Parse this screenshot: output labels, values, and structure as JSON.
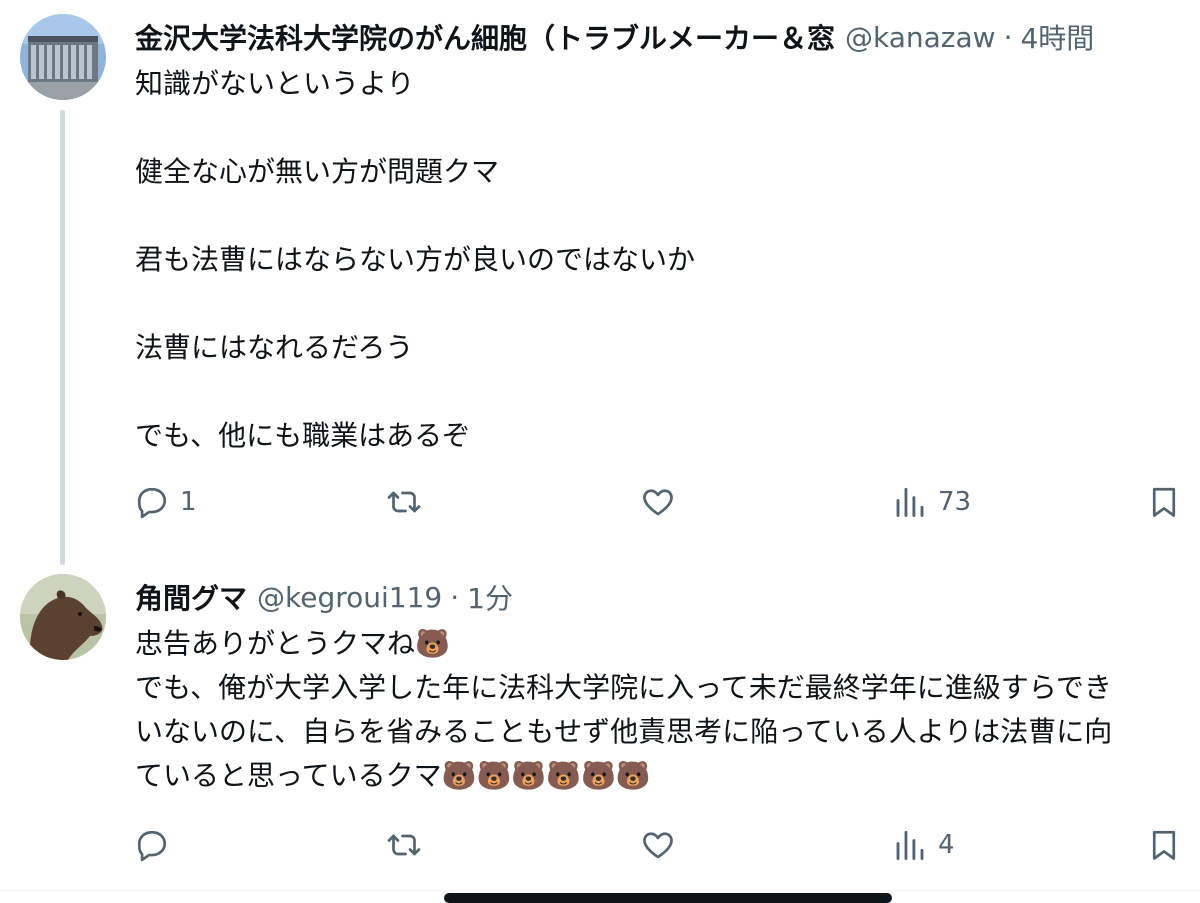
{
  "tweet1": {
    "name": "金沢大学法科大学院のがん細胞（トラブルメーカー＆窓",
    "handle": "@kanazaw",
    "time": "4時間",
    "lines": [
      "知識がないというより",
      "",
      "健全な心が無い方が問題クマ",
      "",
      "君も法曹にはならない方が良いのではないか",
      "",
      "法曹にはなれるだろう",
      "",
      "でも、他にも職業はあるぞ"
    ],
    "reply_count": "1",
    "retweet_count": "",
    "like_count": "",
    "view_count": "73"
  },
  "tweet2": {
    "name": "角間グマ",
    "handle": "@kegroui119",
    "time": "1分",
    "lines": [
      "忠告ありがとうクマね🐻",
      "でも、俺が大学入学した年に法科大学院に入って未だ最終学年に進級すらでき",
      "いないのに、自らを省みることもせず他責思考に陥っている人よりは法曹に向",
      "ていると思っているクマ🐻🐻🐻🐻🐻🐻"
    ],
    "reply_count": "",
    "retweet_count": "",
    "like_count": "",
    "view_count": "4"
  },
  "icons": {
    "reply": "reply-icon",
    "retweet": "retweet-icon",
    "like": "heart-icon",
    "views": "views-icon",
    "bookmark": "bookmark-icon"
  },
  "colors": {
    "text": "#0f1419",
    "secondary": "#536471",
    "thread_line": "#cfd9de"
  }
}
